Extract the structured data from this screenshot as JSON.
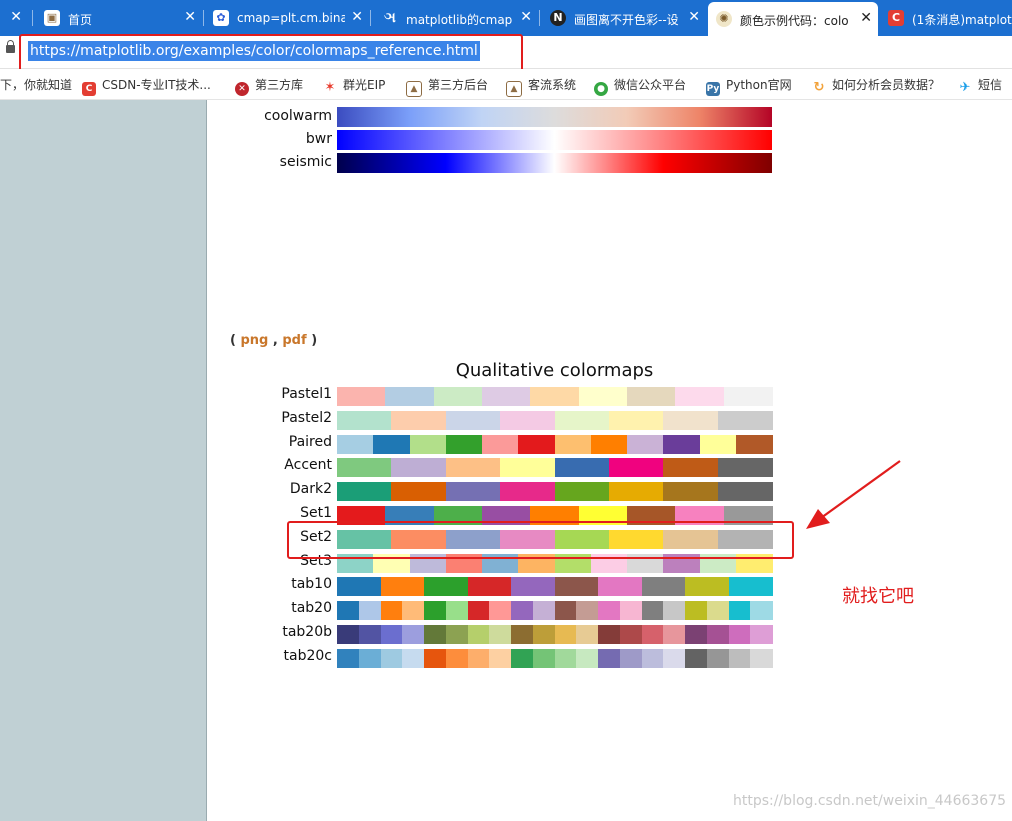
{
  "tabs": [
    {
      "title": "首页",
      "icon": "picture-icon"
    },
    {
      "title": "cmap=plt.cm.bina",
      "icon": "baidu-paw-icon"
    },
    {
      "title": "matplotlib的cmap",
      "icon": "omega-icon"
    },
    {
      "title": "画图离不开色彩--设",
      "icon": "notion-n-icon"
    },
    {
      "title": "颜色示例代码：colo",
      "icon": "matplotlib-icon",
      "active": true
    },
    {
      "title": "(1条消息)matplotli",
      "icon": "csdn-icon"
    }
  ],
  "address": {
    "url": "https://matplotlib.org/examples/color/colormaps_reference.html"
  },
  "bookmarks": [
    {
      "label": "下，你就知道",
      "icon": ""
    },
    {
      "label": "CSDN-专业IT技术...",
      "icon": "csdn-icon",
      "color": "#e33e33"
    },
    {
      "label": "第三方库",
      "icon": "x-icon",
      "color": "#c0262d"
    },
    {
      "label": "群光EIP",
      "icon": "huawei-icon",
      "color": "#e83a2c"
    },
    {
      "label": "第三方后台",
      "icon": "picture-icon",
      "color": "#8d6c44"
    },
    {
      "label": "客流系统",
      "icon": "picture-icon",
      "color": "#8d6c44"
    },
    {
      "label": "微信公众平台",
      "icon": "wechat-icon",
      "color": "#35a743"
    },
    {
      "label": "Python官网",
      "icon": "python-icon",
      "color": "#3a75a8"
    },
    {
      "label": "如何分析会员数据？",
      "icon": "refresh-icon",
      "color": "#f2a23a"
    },
    {
      "label": "短信",
      "icon": "bird-icon",
      "color": "#1b9ee8"
    }
  ],
  "content": {
    "links_open": "(",
    "png": "png",
    "comma": ",",
    "pdf": "pdf",
    "links_close": ")",
    "qualitative_title": "Qualitative colormaps",
    "annotation": "就找它吧",
    "watermark": "https://blog.csdn.net/weixin_44663675"
  },
  "diverging": [
    {
      "name": "coolwarm",
      "gradient": [
        "#3b4cc0",
        "#7b9ff9",
        "#c0d4f5",
        "#dddcdc",
        "#f2cbb7",
        "#ee8468",
        "#b40426"
      ]
    },
    {
      "name": "bwr",
      "gradient": [
        "#0000ff",
        "#8080ff",
        "#ffffff",
        "#ff8080",
        "#ff0000"
      ]
    },
    {
      "name": "seismic",
      "gradient": [
        "#00004c",
        "#0000ff",
        "#ffffff",
        "#ff0000",
        "#7f0000"
      ]
    }
  ],
  "qualitative": [
    {
      "name": "Pastel1",
      "colors": [
        "#fbb4ae",
        "#b3cde3",
        "#ccebc5",
        "#decbe4",
        "#fed9a6",
        "#ffffcc",
        "#e5d8bd",
        "#fddaec",
        "#f2f2f2"
      ]
    },
    {
      "name": "Pastel2",
      "colors": [
        "#b3e2cd",
        "#fdcdac",
        "#cbd5e8",
        "#f4cae4",
        "#e6f5c9",
        "#fff2ae",
        "#f1e2cc",
        "#cccccc"
      ]
    },
    {
      "name": "Paired",
      "colors": [
        "#a6cee3",
        "#1f78b4",
        "#b2df8a",
        "#33a02c",
        "#fb9a99",
        "#e31a1c",
        "#fdbf6f",
        "#ff7f00",
        "#cab2d6",
        "#6a3d9a",
        "#ffff99",
        "#b15928"
      ]
    },
    {
      "name": "Accent",
      "colors": [
        "#7fc97f",
        "#beaed4",
        "#fdc086",
        "#ffff99",
        "#386cb0",
        "#f0027f",
        "#bf5b17",
        "#666666"
      ]
    },
    {
      "name": "Dark2",
      "colors": [
        "#1b9e77",
        "#d95f02",
        "#7570b3",
        "#e7298a",
        "#66a61e",
        "#e6ab02",
        "#a6761d",
        "#666666"
      ]
    },
    {
      "name": "Set1",
      "colors": [
        "#e41a1c",
        "#377eb8",
        "#4daf4a",
        "#984ea3",
        "#ff7f00",
        "#ffff33",
        "#a65628",
        "#f781bf",
        "#999999"
      ]
    },
    {
      "name": "Set2",
      "colors": [
        "#66c2a5",
        "#fc8d62",
        "#8da0cb",
        "#e78ac3",
        "#a6d854",
        "#ffd92f",
        "#e5c494",
        "#b3b3b3"
      ]
    },
    {
      "name": "Set3",
      "colors": [
        "#8dd3c7",
        "#ffffb3",
        "#bebada",
        "#fb8072",
        "#80b1d3",
        "#fdb462",
        "#b3de69",
        "#fccde5",
        "#d9d9d9",
        "#bc80bd",
        "#ccebc5",
        "#ffed6f"
      ]
    },
    {
      "name": "tab10",
      "colors": [
        "#1f77b4",
        "#ff7f0e",
        "#2ca02c",
        "#d62728",
        "#9467bd",
        "#8c564b",
        "#e377c2",
        "#7f7f7f",
        "#bcbd22",
        "#17becf"
      ]
    },
    {
      "name": "tab20",
      "colors": [
        "#1f77b4",
        "#aec7e8",
        "#ff7f0e",
        "#ffbb78",
        "#2ca02c",
        "#98df8a",
        "#d62728",
        "#ff9896",
        "#9467bd",
        "#c5b0d5",
        "#8c564b",
        "#c49c94",
        "#e377c2",
        "#f7b6d2",
        "#7f7f7f",
        "#c7c7c7",
        "#bcbd22",
        "#dbdb8d",
        "#17becf",
        "#9edae5"
      ]
    },
    {
      "name": "tab20b",
      "colors": [
        "#393b79",
        "#5254a3",
        "#6b6ecf",
        "#9c9ede",
        "#637939",
        "#8ca252",
        "#b5cf6b",
        "#cedb9c",
        "#8c6d31",
        "#bd9e39",
        "#e7ba52",
        "#e7cb94",
        "#843c39",
        "#ad494a",
        "#d6616b",
        "#e7969c",
        "#7b4173",
        "#a55194",
        "#ce6dbd",
        "#de9ed6"
      ]
    },
    {
      "name": "tab20c",
      "colors": [
        "#3182bd",
        "#6baed6",
        "#9ecae1",
        "#c6dbef",
        "#e6550d",
        "#fd8d3c",
        "#fdae6b",
        "#fdd0a2",
        "#31a354",
        "#74c476",
        "#a1d99b",
        "#c7e9c0",
        "#756bb1",
        "#9e9ac8",
        "#bcbddc",
        "#dadaeb",
        "#636363",
        "#969696",
        "#bdbdbd",
        "#d9d9d9"
      ]
    }
  ],
  "highlight_row": "Set2",
  "colors": {
    "tab_strip": "#1c6fd0",
    "url_highlight": "#3a84e8",
    "annotation_red": "#e11d1d",
    "link_orange": "#c9772b",
    "panel": "#c0d0d4"
  }
}
